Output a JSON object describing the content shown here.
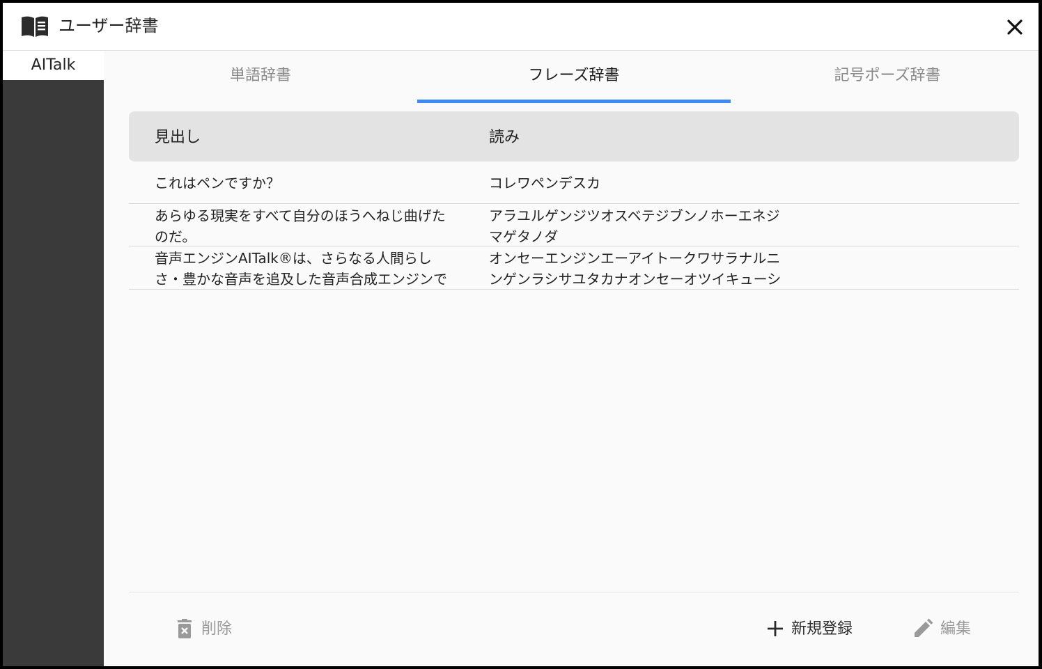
{
  "window": {
    "title": "ユーザー辞書",
    "icon": "book-icon",
    "close_icon": "close-icon"
  },
  "sidebar": {
    "items": [
      {
        "label": "AITalk",
        "selected": true
      }
    ]
  },
  "tabs": [
    {
      "label": "単語辞書",
      "active": false
    },
    {
      "label": "フレーズ辞書",
      "active": true
    },
    {
      "label": "記号ポーズ辞書",
      "active": false
    }
  ],
  "table": {
    "columns": [
      "見出し",
      "読み"
    ],
    "rows": [
      {
        "heading": "これはペンですか？",
        "reading": "コレワペンデスカ"
      },
      {
        "heading": "あらゆる現実をすべて自分のほうへねじ曲げた\nのだ。",
        "reading": "アラユルゲンジツオスベテジブンノホーエネジ\nマゲタノダ"
      },
      {
        "heading": "音声エンジンAITalk®は、さらなる人間らし\nさ・豊かな音声を追及した音声合成エンジンで",
        "reading": "オンセーエンジンエーアイトークワサラナルニ\nンゲンラシサユタカナオンセーオツイキューシ"
      }
    ]
  },
  "footer": {
    "delete_label": "削除",
    "delete_icon": "trash-icon",
    "new_label": "新規登録",
    "new_icon": "plus-icon",
    "edit_label": "編集",
    "edit_icon": "pencil-icon"
  },
  "colors": {
    "accent": "#3d8af7",
    "sidebar_bg": "#3a3a3a",
    "header_bg": "#e3e3e3",
    "disabled_text": "#9a9a9a"
  }
}
